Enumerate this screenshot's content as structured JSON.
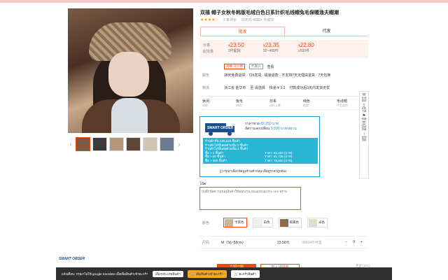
{
  "product": {
    "title": "双禧 帽子女秋冬韩版毛绒白色日系针织毛线帽兔毛保暖渔夫帽潮",
    "rating_text": "★★★★☆",
    "reviews": "2 条评价",
    "sales": "30天内 4000+ 件成交",
    "tabs": [
      "批发",
      "代发"
    ]
  },
  "prices": {
    "label1": "价格",
    "label2": "起批量",
    "items": [
      {
        "price": "23.50",
        "qty": "2件起批"
      },
      {
        "price": "23.35",
        "qty": "50~499件"
      },
      {
        "price": "22.80",
        "qty": "≥500件"
      }
    ]
  },
  "service": {
    "k": "服务",
    "badges": [
      "退换·订价赠",
      "代发价"
    ],
    "more": "查看"
  },
  "service2": {
    "k": "服务",
    "v": "38天免费退货 · 72h发货 · 极速退款 · 不支持7天无理由退货 · 7天包换"
  },
  "shipping": {
    "k": "物流",
    "from": "浙江省 金华市",
    "to": "至 请选择",
    "carrier": "快递 ¥ 3.2",
    "note": "付款成功后3天内发货无忧"
  },
  "attrs": [
    {
      "a": "休闲",
      "b": "风格"
    },
    {
      "a": "兔毛",
      "b": "材质"
    },
    {
      "a": "日系",
      "b": "流行元素"
    },
    {
      "a": "纯色",
      "b": "图案"
    },
    {
      "a": "毛线帽",
      "b": "产品类别"
    }
  ],
  "smartorder": {
    "brand": "SMART ORDER",
    "unit_label": "ราคาขาย",
    "unit_value": "82,250 บาท",
    "rate_label": "อัตราแลกเปลี่ยน",
    "rate_value": "3,500 บาท/หยวน",
    "lines": [
      "ร้านค้าขั้น 225,540 ชิ้นค้า",
      "ร้านค้าได้ขั้นต่อด้วยขั้น 2 ชิ้นค้า",
      "ร้านค้าได้ขั้นต่อด้วยขั้น 2 ชิ้นค้า",
      "ซื้อ > 2 ชิ้นค้า",
      "ซื้อ > 50 ชิ้นค้า",
      "ซื้อ > 500 ชิ้นค้า"
    ],
    "right_lines": [
      "ราคา: 82,250 (บาท)",
      "ราคา: 81,725 (บาท)",
      "ราคา: 79,800 (บาท)"
    ],
    "note": "[!] กรุณาเลือกข้อมูลร้านค้าก่อน เพื่อดูราคาถูกต้อง"
  },
  "note_field": {
    "label": "โน้ต",
    "placeholder": "บันทึกข้อความของสินค้าให้พนักงาน SmartOrderTH.com ทราบ"
  },
  "colors": {
    "k": "颜色",
    "items": [
      "卡其色",
      "白色",
      "褐黄色",
      "米色"
    ]
  },
  "size": {
    "k": "尺码",
    "v": "M（56~58cm）",
    "price": "23.50元",
    "stock": "99894件可售",
    "qty": "0"
  },
  "logo_text": "SMART ORDER",
  "buttons": {
    "b1": "立即订购",
    "b2": "加入进货单"
  },
  "popular": "热卖 (221)",
  "side": [
    "在线咨询",
    "手机下单",
    "举报",
    "加进货单",
    "返回顶部"
  ],
  "bottom": {
    "msg": "แจ้งเตือน: กรุณาไม่ใช้ google translate เมื่อเพิ่มสินค้าเข้าตะกร้า",
    "select": "เลือกประเภทสินค้า",
    "add": "เพิ่มสินค้าเข้าตะกร้า",
    "cart": "ตะกร้าสินค้า"
  }
}
